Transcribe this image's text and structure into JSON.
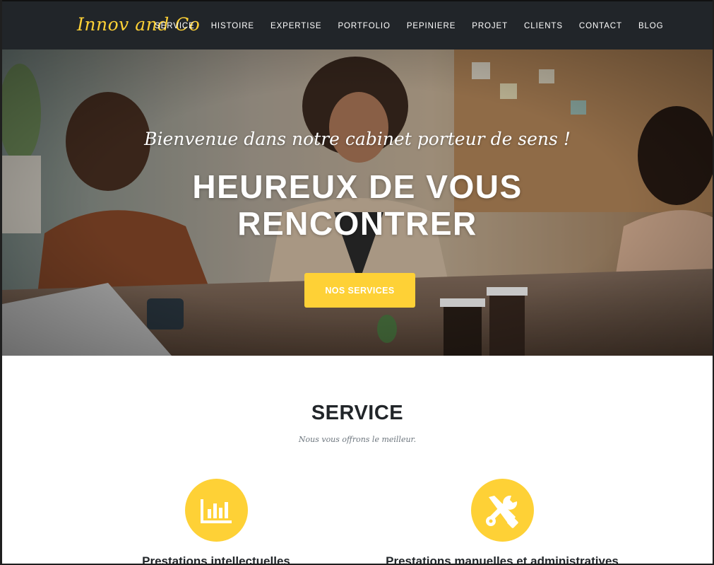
{
  "navbar": {
    "brand": "Innov and Co",
    "items": [
      {
        "label": "SERVICE"
      },
      {
        "label": "HISTOIRE"
      },
      {
        "label": "EXPERTISE"
      },
      {
        "label": "PORTFOLIO"
      },
      {
        "label": "PEPINIERE"
      },
      {
        "label": "PROJET"
      },
      {
        "label": "CLIENTS"
      },
      {
        "label": "CONTACT"
      },
      {
        "label": "BLOG"
      }
    ]
  },
  "hero": {
    "subtitle": "Bienvenue dans notre cabinet porteur de sens !",
    "title_line1": "HEUREUX DE VOUS",
    "title_line2": "RENCONTRER",
    "button_label": "NOS SERVICES"
  },
  "service": {
    "title": "SERVICE",
    "subtitle": "Nous vous offrons le meilleur.",
    "items": [
      {
        "title": "Prestations intellectuelles",
        "icon": "bar-chart-icon"
      },
      {
        "title": "Prestations manuelles et administratives",
        "icon": "tools-icon"
      }
    ]
  },
  "colors": {
    "accent": "#fed136",
    "navbar_bg": "#212529",
    "heading": "#212529",
    "muted": "#6c757d"
  }
}
